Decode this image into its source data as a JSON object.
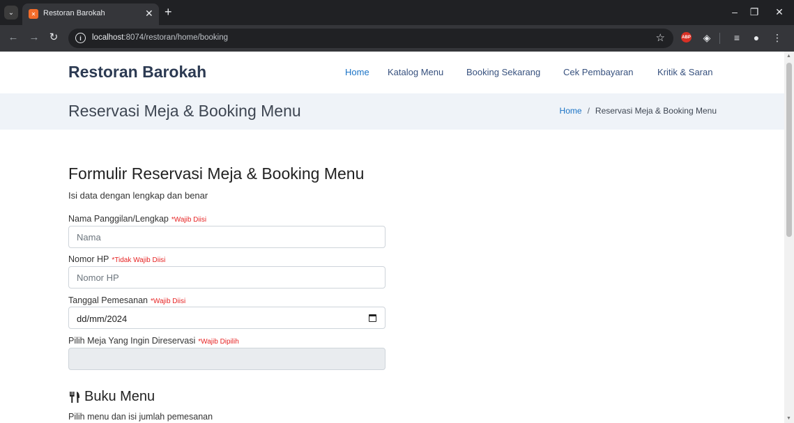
{
  "browser": {
    "tab_title": "Restoran Barokah",
    "url_host": "localhost",
    "url_rest": ":8074/restoran/home/booking"
  },
  "navbar": {
    "brand": "Restoran Barokah",
    "links": [
      "Home",
      "Katalog Menu",
      "Booking Sekarang",
      "Cek Pembayaran",
      "Kritik & Saran"
    ]
  },
  "breadcrumbs": {
    "title": "Reservasi Meja & Booking Menu",
    "home": "Home",
    "separator": "/",
    "current": "Reservasi Meja & Booking Menu"
  },
  "form": {
    "title": "Formulir Reservasi Meja & Booking Menu",
    "subtitle": "Isi data dengan lengkap dan benar",
    "name_label": "Nama Panggilan/Lengkap",
    "name_req": "*Wajib Diisi",
    "name_placeholder": "Nama",
    "phone_label": "Nomor HP",
    "phone_req": "*Tidak Wajib Diisi",
    "phone_placeholder": "Nomor HP",
    "date_label": "Tanggal Pemesanan",
    "date_req": "*Wajib Diisi",
    "date_value": "dd/mm/2024",
    "table_label": "Pilih Meja Yang Ingin Direservasi",
    "table_req": "*Wajib Dipilih"
  },
  "menu_section": {
    "title": "Buku Menu",
    "subtitle": "Pilih menu dan isi jumlah pemesanan"
  },
  "icons": {
    "menu": "utensils-icon",
    "favicon": "xampp-favicon-icon"
  },
  "colors": {
    "accent": "#1a73c6",
    "brand": "#2c3a52",
    "required": "#e62424",
    "breadcrumb_bg": "#eff3f8"
  }
}
